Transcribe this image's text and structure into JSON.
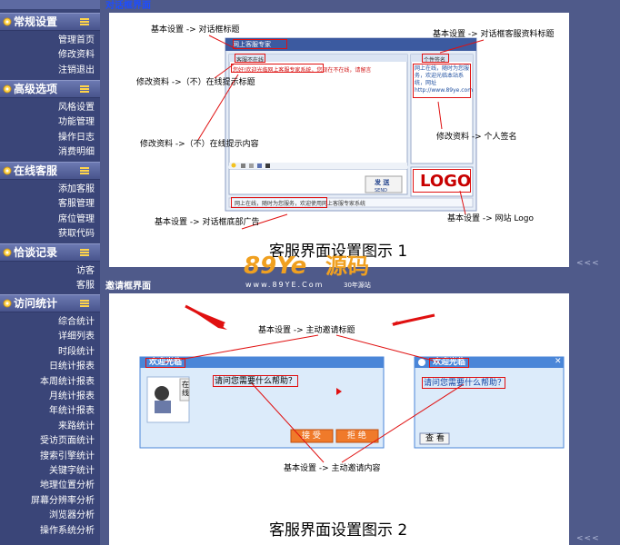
{
  "sidebar": {
    "sections": [
      {
        "title": "常规设置",
        "items": [
          "管理首页",
          "修改资料",
          "注销退出"
        ]
      },
      {
        "title": "高级选项",
        "items": [
          "风格设置",
          "功能管理",
          "操作日志",
          "消费明细"
        ]
      },
      {
        "title": "在线客服",
        "items": [
          "添加客服",
          "客服管理",
          "席位管理",
          "获取代码"
        ]
      },
      {
        "title": "恰谈记录",
        "items": [
          "访客",
          "客服"
        ]
      },
      {
        "title": "访问统计",
        "items": [
          "综合统计",
          "详细列表",
          "时段统计",
          "日统计报表",
          "本周统计报表",
          "月统计报表",
          "年统计报表",
          "来路统计",
          "受访页面统计",
          "搜索引擎统计",
          "关键字统计",
          "地理位置分析",
          "屏幕分辨率分析",
          "浏览器分析",
          "操作系统分析"
        ]
      }
    ]
  },
  "panel1": {
    "caption": "对话框界面",
    "annotations": {
      "title": "基本设置 -> 对话框标题",
      "customer_title": "基本设置 -> 对话框客服资料标题",
      "online_tip_title": "修改资料 ->（不）在线提示标题",
      "online_tip_content": "修改资料 ->（不）在线提示内容",
      "signature": "修改资料 -> 个人签名",
      "bottom_ad": "基本设置 -> 对话框底部广告",
      "logo": "基本设置 -> 网站 Logo"
    },
    "mock": {
      "window_title": "网上客服专家",
      "left_header": "客服不在线",
      "tip_text": "您好!欢迎光临网上客服专家系统，您现在不在线，请留言",
      "right_header": "个性签名",
      "signature_text": "网上在线，随时为您服务，欢迎光临本站系统，网址 http://www.89ye.com",
      "send_label": "发 送",
      "send_sub": "SEND",
      "logo_text": "LOGO",
      "bottom_text": "网上在线，随时为您服务，欢迎使用网上客服专家系统"
    },
    "caption_big": "客服界面设置图示 1"
  },
  "watermark": {
    "brand_latin": "89Ye",
    "brand_cjk": "源码",
    "url": "www.89YE.Com",
    "tagline": "30年源站"
  },
  "panel2": {
    "caption": "邀请框界面",
    "annotations": {
      "invite_title": "基本设置 -> 主动邀请标题",
      "invite_content": "基本设置 -> 主动邀请内容"
    },
    "mock": {
      "welcome": "欢迎光临",
      "question": "请问您需要什么帮助？",
      "online_label": "在线",
      "accept_label": "接 受",
      "reject_label": "拒 绝",
      "view_label": "查 看",
      "close_glyph": "✕"
    },
    "caption_big": "客服界面设置图示 2"
  },
  "more": "<<<",
  "colors": {
    "sidebar_bg": "#3a4578",
    "accent_yellow": "#ffd44a",
    "highlight_red": "#e01010",
    "invite_blue": "#4a86d8",
    "brand_orange": "#f0a020"
  }
}
